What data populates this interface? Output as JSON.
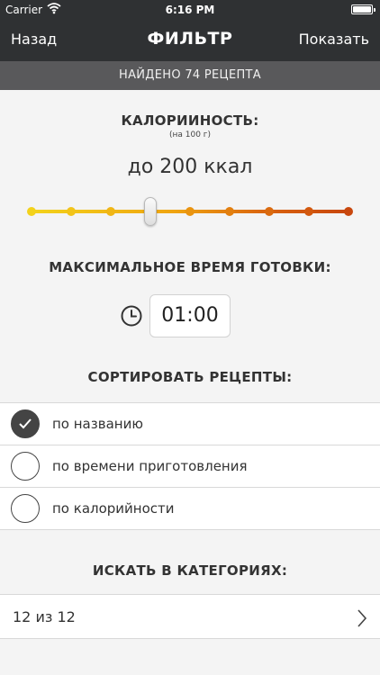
{
  "status_bar": {
    "carrier": "Carrier",
    "time": "6:16 PM"
  },
  "nav": {
    "back_label": "Назад",
    "title": "ФИЛЬТР",
    "show_label": "Показать"
  },
  "found": {
    "text": "НАЙДЕНО 74 РЕЦЕПТА"
  },
  "calories": {
    "title": "КАЛОРИИНОСТЬ:",
    "note": "(на 100 г)",
    "value_label": "до 200 ккал",
    "slider": {
      "steps": 9,
      "selected_index": 3
    }
  },
  "cook_time": {
    "title": "МАКСИМАЛЬНОЕ ВРЕМЯ ГОТОВКИ:",
    "value": "01:00"
  },
  "sort": {
    "title": "СОРТИРОВАТЬ РЕЦЕПТЫ:",
    "options": [
      {
        "label": "по названию",
        "checked": true
      },
      {
        "label": "по времени приготовления",
        "checked": false
      },
      {
        "label": "по калорийности",
        "checked": false
      }
    ]
  },
  "categories": {
    "title": "ИСКАТЬ В КАТЕГОРИЯХ:",
    "value": "12 из 12"
  },
  "colors": {
    "bar_bg": "#2f3133",
    "found_bg": "#59595b",
    "slider_dots": [
      "#f3d21b",
      "#f2c419",
      "#f0b615",
      "#efa812",
      "#e99410",
      "#e27f0f",
      "#da6a0f",
      "#d2580e",
      "#c8470d"
    ]
  }
}
